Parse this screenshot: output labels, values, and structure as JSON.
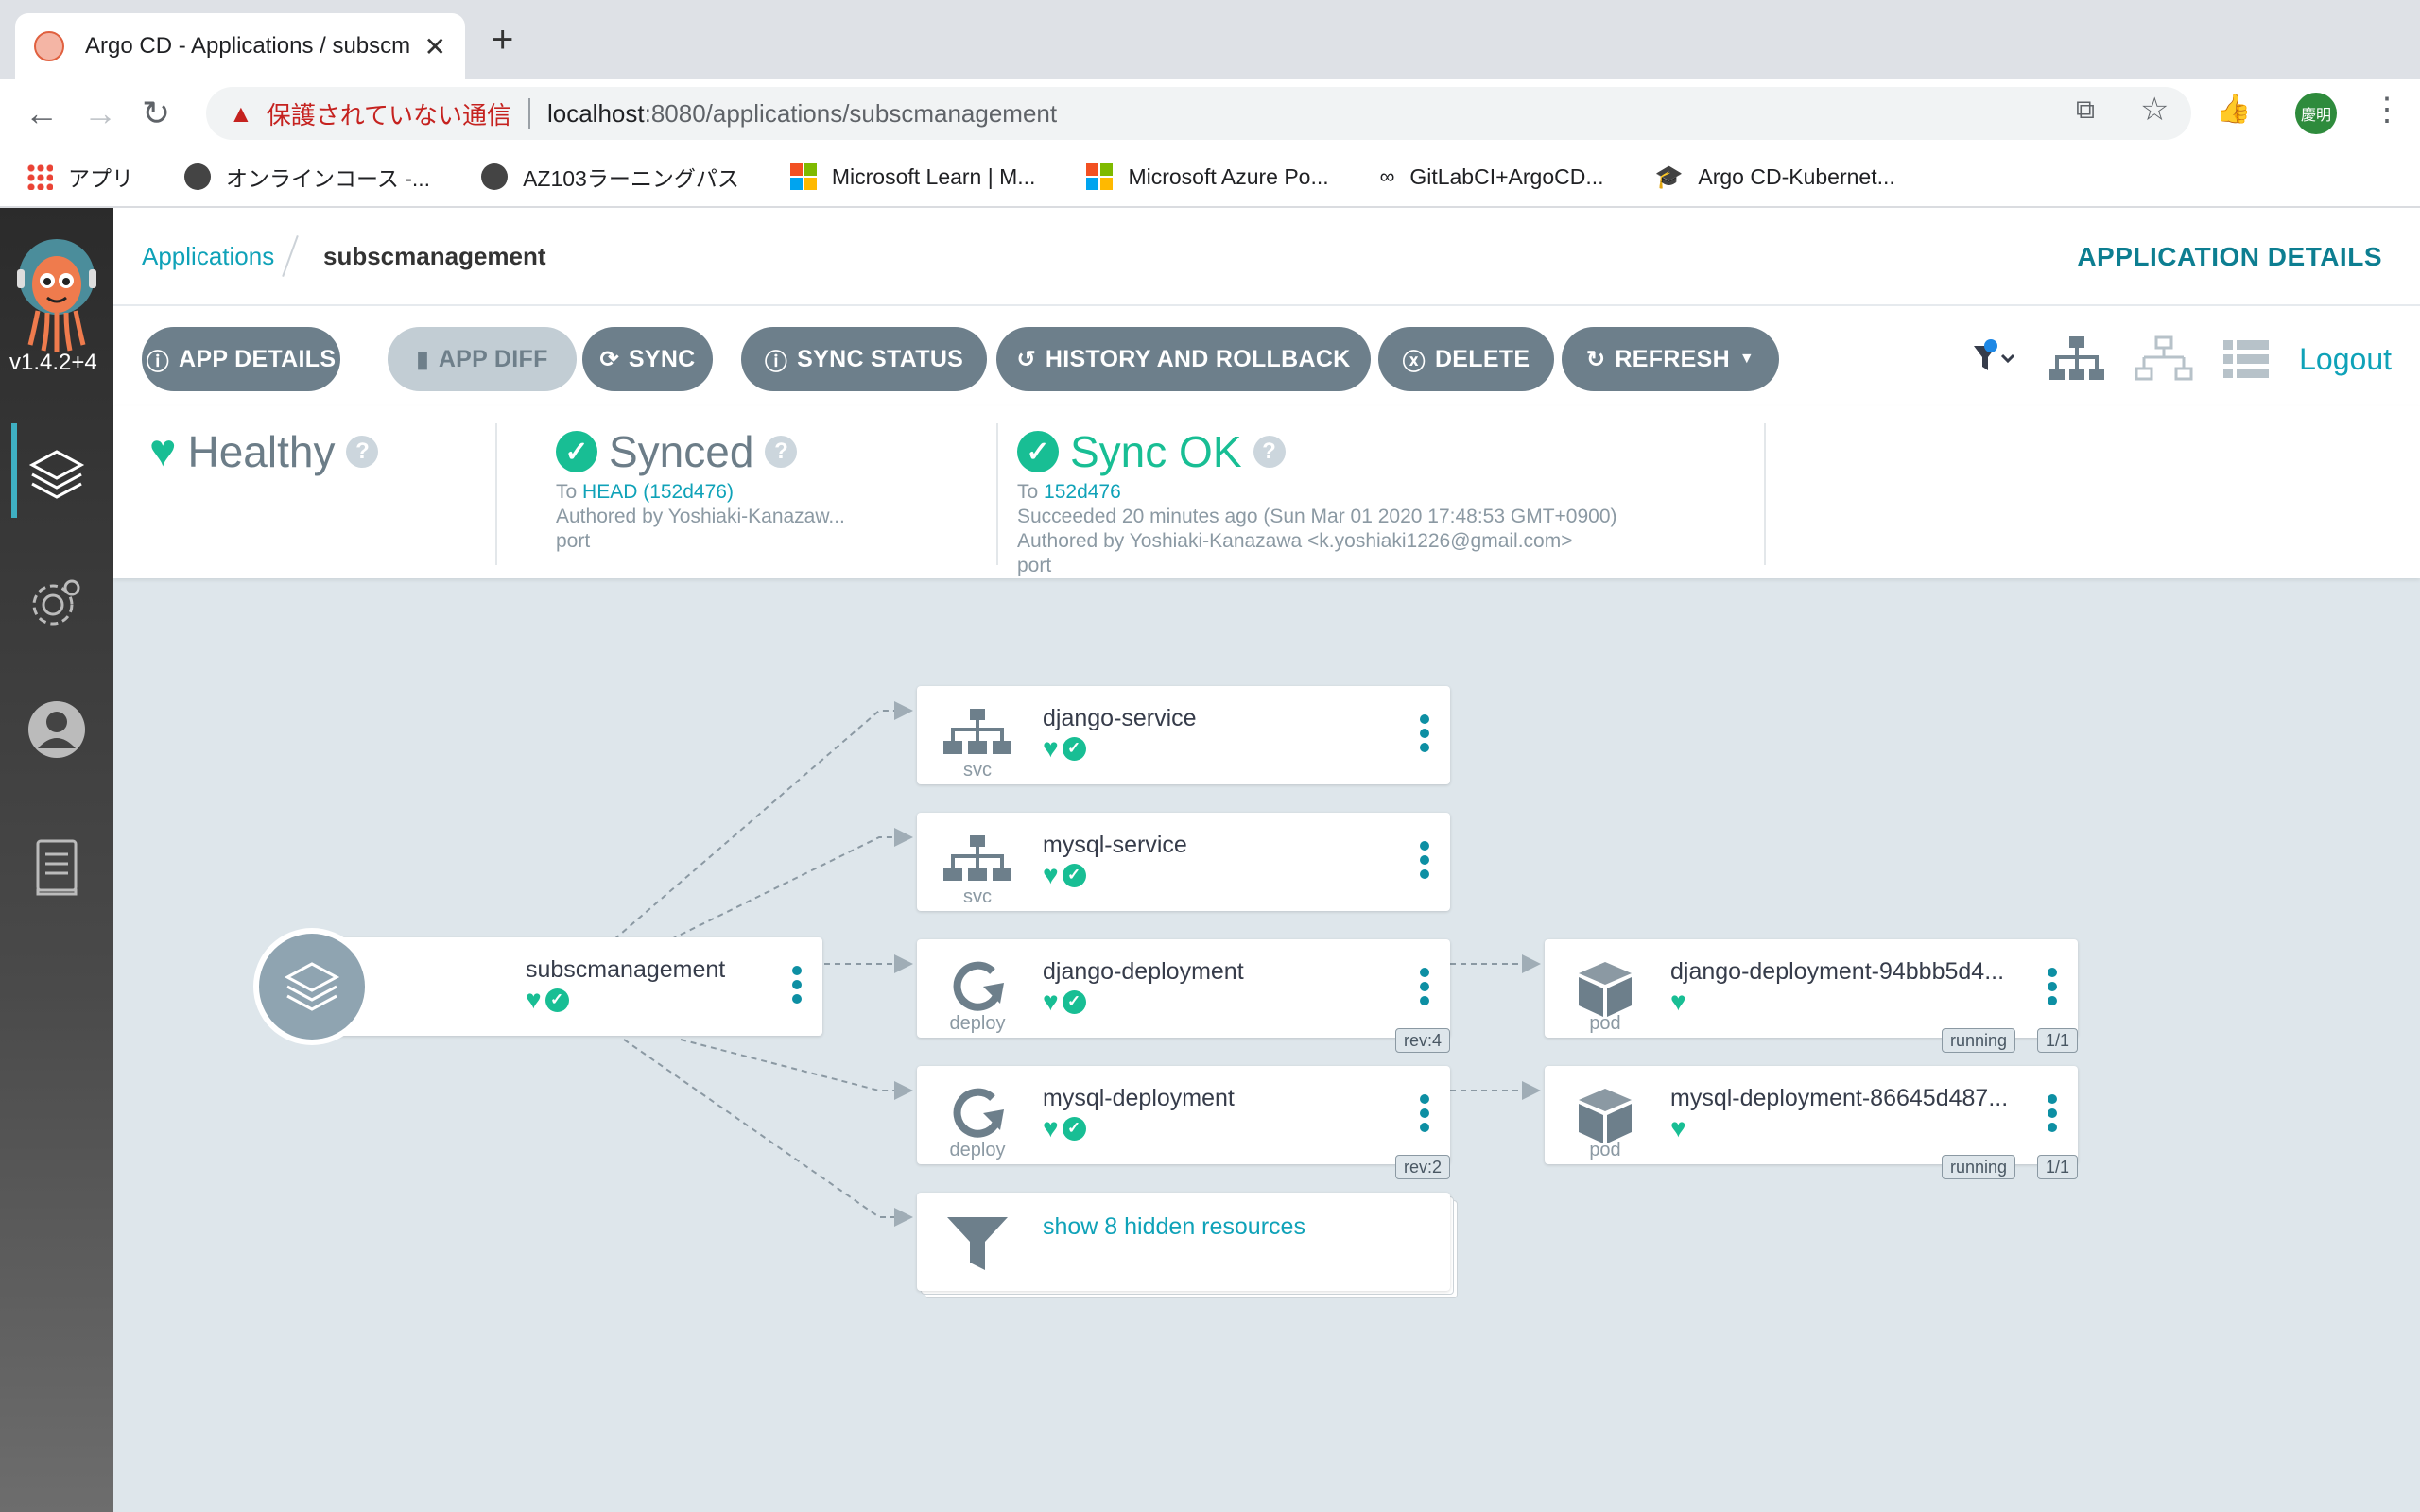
{
  "browser": {
    "tab_title": "Argo CD - Applications / subscm",
    "address_insecure": "保護されていない通信",
    "address_host": "localhost",
    "address_path": ":8080/applications/subscmanagement",
    "profile_initials": "慶明",
    "bookmarks": [
      {
        "label": "アプリ",
        "icon": "apps-grid-icon"
      },
      {
        "label": "オンラインコース -...",
        "icon": "globe-icon"
      },
      {
        "label": "AZ103ラーニングパス",
        "icon": "globe-icon"
      },
      {
        "label": "Microsoft Learn | M...",
        "icon": "microsoft-icon"
      },
      {
        "label": "Microsoft Azure Po...",
        "icon": "microsoft-icon"
      },
      {
        "label": "GitLabCI+ArgoCD...",
        "icon": "link-icon"
      },
      {
        "label": "Argo CD-Kubernet...",
        "icon": "graduation-cap-icon"
      }
    ]
  },
  "sidebar": {
    "version": "v1.4.2+4"
  },
  "header": {
    "breadcrumb_link": "Applications",
    "breadcrumb_current": "subscmanagement",
    "page_title": "APPLICATION DETAILS",
    "logout": "Logout"
  },
  "toolbar": {
    "buttons": [
      {
        "label": "APP DETAILS",
        "icon": "info-icon",
        "disabled": false
      },
      {
        "label": "APP DIFF",
        "icon": "file-diff-icon",
        "disabled": true
      },
      {
        "label": "SYNC",
        "icon": "sync-icon",
        "disabled": false
      },
      {
        "label": "SYNC STATUS",
        "icon": "info-icon",
        "disabled": false
      },
      {
        "label": "HISTORY AND ROLLBACK",
        "icon": "history-icon",
        "disabled": false
      },
      {
        "label": "DELETE",
        "icon": "times-circle-icon",
        "disabled": false
      },
      {
        "label": "REFRESH",
        "icon": "refresh-icon",
        "disabled": false
      }
    ]
  },
  "status": {
    "health": "Healthy",
    "sync": {
      "label": "Synced",
      "to_prefix": "To",
      "revision": "HEAD (152d476)",
      "author": "Authored by Yoshiaki-Kanazaw...",
      "message": "port"
    },
    "operation": {
      "label": "Sync OK",
      "to_prefix": "To",
      "revision": "152d476",
      "succeeded": "Succeeded 20 minutes ago (Sun Mar 01 2020 17:48:53 GMT+0900)",
      "author": "Authored by Yoshiaki-Kanazawa <k.yoshiaki1226@gmail.com>",
      "message": "port"
    }
  },
  "tree": {
    "app": {
      "name": "subscmanagement"
    },
    "nodes": [
      {
        "name": "django-service",
        "kind": "svc"
      },
      {
        "name": "mysql-service",
        "kind": "svc"
      },
      {
        "name": "django-deployment",
        "kind": "deploy",
        "rev": "rev:4"
      },
      {
        "name": "mysql-deployment",
        "kind": "deploy",
        "rev": "rev:2"
      },
      {
        "name": "django-deployment-94bbb5d4...",
        "kind": "pod",
        "state": "running",
        "ready": "1/1"
      },
      {
        "name": "mysql-deployment-86645d487...",
        "kind": "pod",
        "state": "running",
        "ready": "1/1"
      }
    ],
    "hidden": "show 8 hidden resources"
  },
  "colors": {
    "accent": "#0fa2b8",
    "healthy": "#18be94",
    "button": "#6d7f8b"
  }
}
